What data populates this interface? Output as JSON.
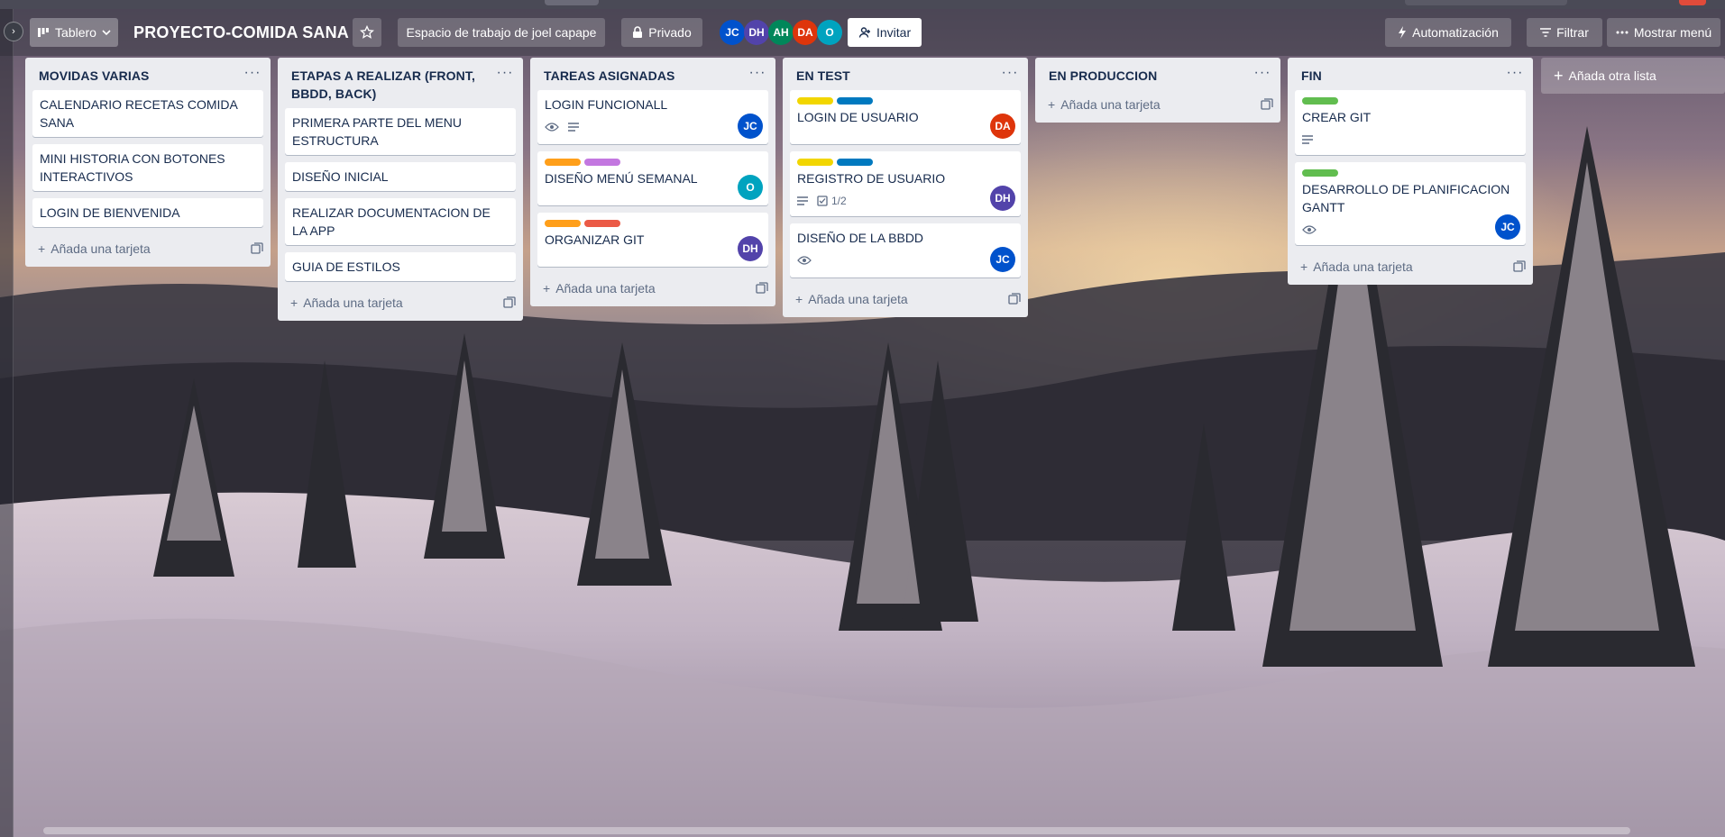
{
  "header": {
    "view_label": "Tablero",
    "board_title": "PROYECTO-COMIDA SANA",
    "workspace_label": "Espacio de trabajo de joel capape",
    "visibility_label": "Privado",
    "invite_label": "Invitar",
    "automation_label": "Automatización",
    "filter_label": "Filtrar",
    "menu_label": "Mostrar menú",
    "members": [
      {
        "initials": "JC",
        "color": "#0052cc"
      },
      {
        "initials": "DH",
        "color": "#5243aa"
      },
      {
        "initials": "AH",
        "color": "#00875a"
      },
      {
        "initials": "DA",
        "color": "#de350b"
      },
      {
        "initials": "O",
        "color": "#00a3bf"
      }
    ]
  },
  "colors": {
    "yellow": "#f2d600",
    "blue": "#0079bf",
    "orange": "#ff9f1a",
    "purple": "#c377e0",
    "red": "#eb5a46",
    "green": "#61bd4f"
  },
  "add_card_label": "Añada una tarjeta",
  "add_list_label": "Añada otra lista",
  "lists": [
    {
      "title": "MOVIDAS VARIAS",
      "cards": [
        {
          "title": "CALENDARIO RECETAS COMIDA SANA"
        },
        {
          "title": "MINI HISTORIA CON BOTONES INTERACTIVOS"
        },
        {
          "title": "LOGIN DE BIENVENIDA"
        }
      ]
    },
    {
      "title": "ETAPAS A REALIZAR (FRONT, BBDD, BACK)",
      "cards": [
        {
          "title": "PRIMERA PARTE DEL MENU ESTRUCTURA"
        },
        {
          "title": "DISEÑO INICIAL"
        },
        {
          "title": "REALIZAR DOCUMENTACION DE LA APP"
        },
        {
          "title": "GUIA DE ESTILOS"
        }
      ]
    },
    {
      "title": "TAREAS ASIGNADAS",
      "cards": [
        {
          "title": "LOGIN FUNCIONALL",
          "badges": [
            "eye-icon",
            "description-icon"
          ],
          "member": "JC"
        },
        {
          "title": "DISEÑO MENÚ SEMANAL",
          "labels": [
            "orange",
            "purple"
          ],
          "member": "O"
        },
        {
          "title": "ORGANIZAR GIT",
          "labels": [
            "orange",
            "red"
          ],
          "member": "DH"
        }
      ]
    },
    {
      "title": "EN TEST",
      "cards": [
        {
          "title": "LOGIN DE USUARIO",
          "labels": [
            "yellow",
            "blue"
          ],
          "member": "DA"
        },
        {
          "title": "REGISTRO DE USUARIO",
          "labels": [
            "yellow",
            "blue"
          ],
          "badges": [
            "description-icon",
            "checklist-icon"
          ],
          "checklist": "1/2",
          "member": "DH"
        },
        {
          "title": "DISEÑO DE LA BBDD",
          "badges": [
            "eye-icon"
          ],
          "member": "JC"
        }
      ]
    },
    {
      "title": "EN PRODUCCION",
      "cards": []
    },
    {
      "title": "FIN",
      "cards": [
        {
          "title": "CREAR GIT",
          "labels": [
            "green"
          ],
          "badges": [
            "description-icon"
          ]
        },
        {
          "title": "DESARROLLO DE PLANIFICACION GANTT",
          "labels": [
            "green"
          ],
          "badges": [
            "eye-icon"
          ],
          "member": "JC"
        }
      ]
    }
  ]
}
